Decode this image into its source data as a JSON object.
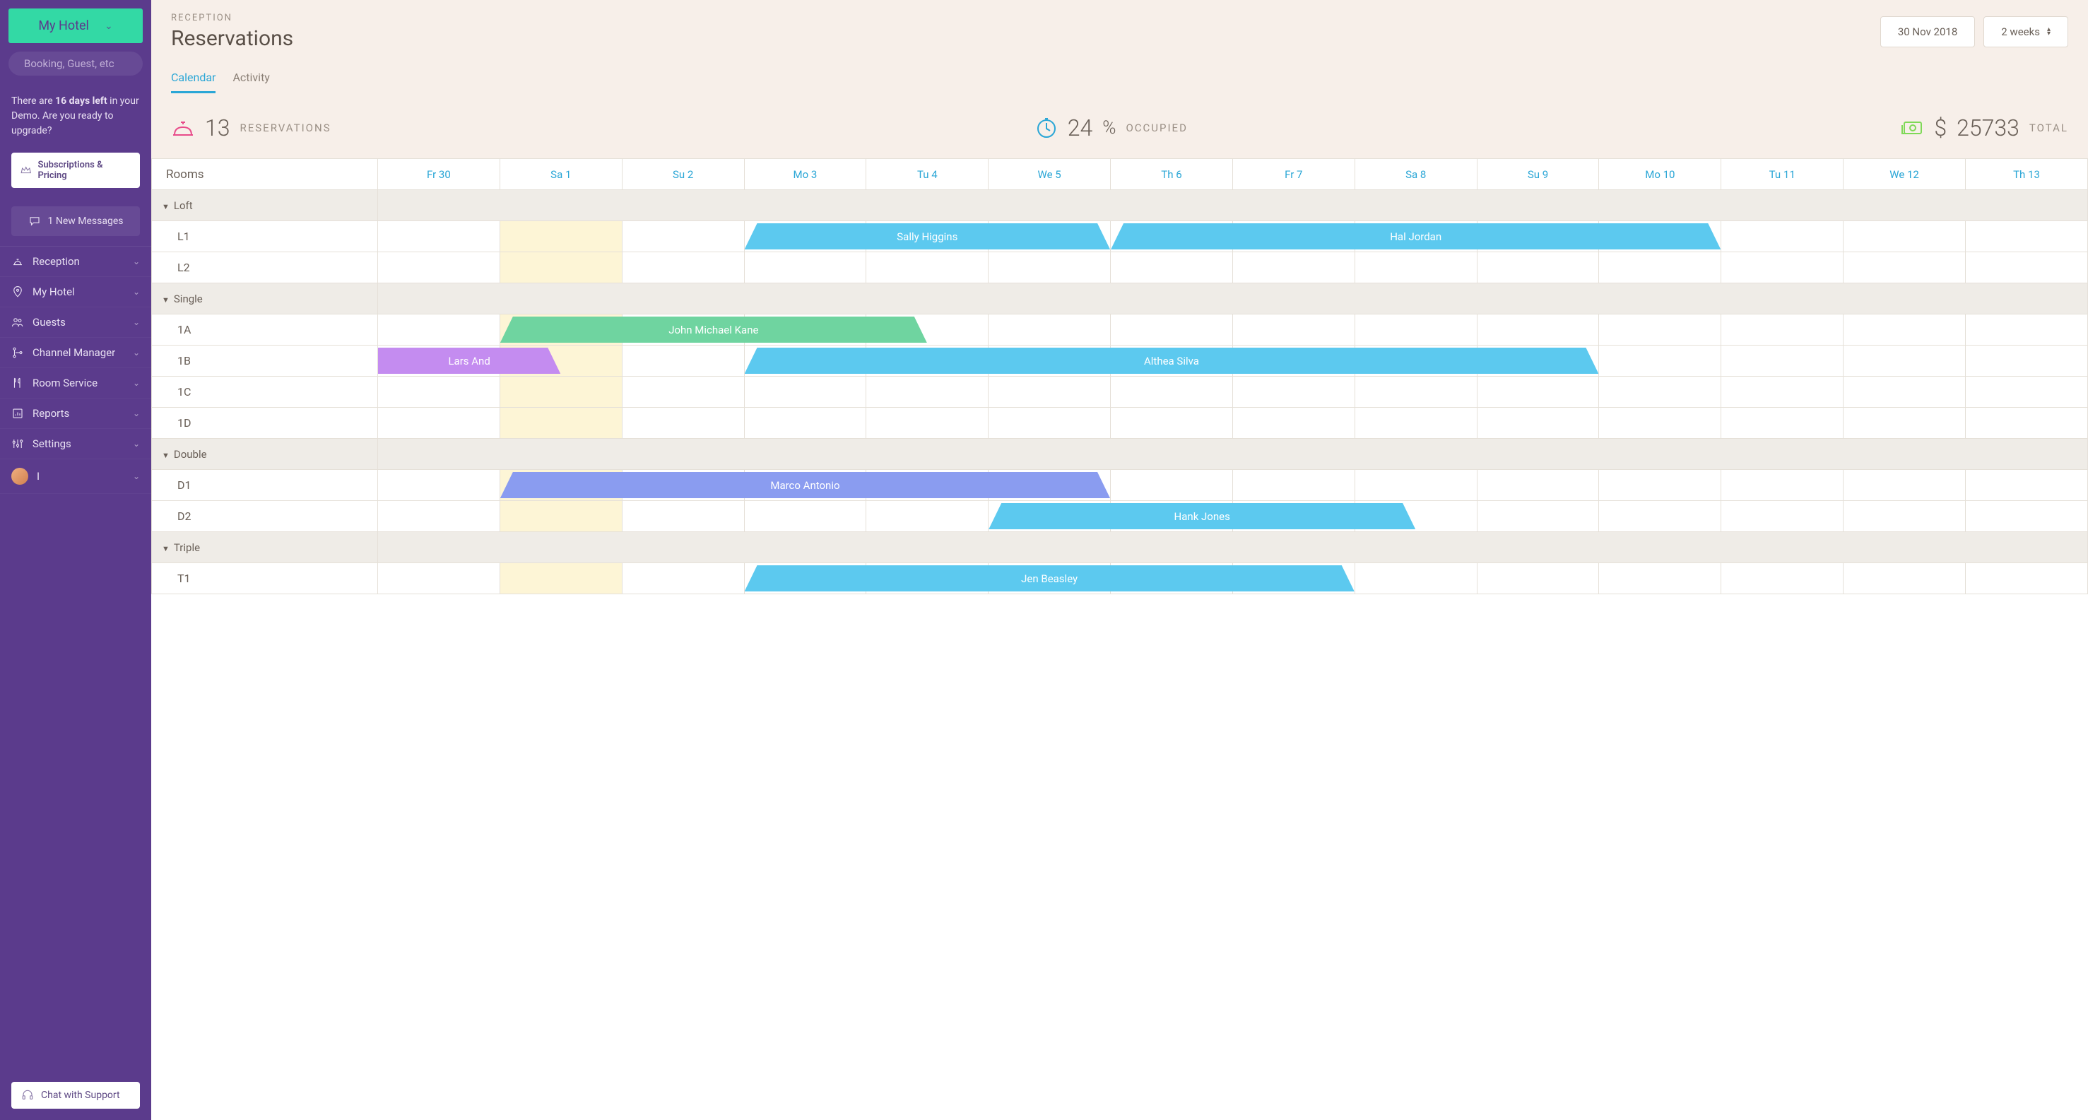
{
  "sidebar": {
    "hotel_select": "My Hotel",
    "search_placeholder": "Booking, Guest, etc",
    "demo_pre": "There are ",
    "demo_bold": "16 days left",
    "demo_post": " in your Demo. Are you ready to upgrade?",
    "subscriptions_label": "Subscriptions & Pricing",
    "messages_label": "1 New Messages",
    "nav": [
      {
        "label": "Reception"
      },
      {
        "label": "My Hotel"
      },
      {
        "label": "Guests"
      },
      {
        "label": "Channel Manager"
      },
      {
        "label": "Room Service"
      },
      {
        "label": "Reports"
      },
      {
        "label": "Settings"
      },
      {
        "label": "I"
      }
    ],
    "support_label": "Chat with Support"
  },
  "header": {
    "breadcrumb": "RECEPTION",
    "title": "Reservations",
    "date_label": "30 Nov 2018",
    "range_label": "2 weeks",
    "tabs": {
      "calendar": "Calendar",
      "activity": "Activity"
    }
  },
  "stats": {
    "reservations_value": "13",
    "reservations_label": "RESERVATIONS",
    "occupied_value": "24",
    "occupied_pct": "%",
    "occupied_label": "OCCUPIED",
    "total_currency": "$",
    "total_value": "25733",
    "total_label": "TOTAL"
  },
  "calendar": {
    "rooms_header": "Rooms",
    "days": [
      "Fr 30",
      "Sa 1",
      "Su 2",
      "Mo 3",
      "Tu 4",
      "We 5",
      "Th 6",
      "Fr 7",
      "Sa 8",
      "Su 9",
      "Mo 10",
      "Tu 11",
      "We 12",
      "Th 13"
    ],
    "today_index": 1,
    "groups": [
      {
        "name": "Loft",
        "rooms": [
          {
            "name": "L1",
            "res": [
              {
                "guest": "Sally Higgins",
                "start": 3,
                "span": 3,
                "color": "#5cc9ef",
                "shape": "normal"
              },
              {
                "guest": "Hal Jordan",
                "start": 6,
                "span": 5,
                "color": "#5cc9ef",
                "shape": "normal"
              }
            ]
          },
          {
            "name": "L2",
            "res": []
          }
        ]
      },
      {
        "name": "Single",
        "rooms": [
          {
            "name": "1A",
            "res": [
              {
                "guest": "John Michael Kane",
                "start": 1,
                "span": 3.5,
                "color": "#6fd4a0",
                "shape": "normal"
              }
            ]
          },
          {
            "name": "1B",
            "res": [
              {
                "guest": "Lars And",
                "start": 0,
                "span": 1.5,
                "color": "#c48cf0",
                "shape": "cut-left"
              },
              {
                "guest": "Althea Silva",
                "start": 3,
                "span": 7,
                "color": "#5cc9ef",
                "shape": "normal"
              }
            ]
          },
          {
            "name": "1C",
            "res": []
          },
          {
            "name": "1D",
            "res": []
          }
        ]
      },
      {
        "name": "Double",
        "rooms": [
          {
            "name": "D1",
            "res": [
              {
                "guest": "Marco Antonio",
                "start": 1,
                "span": 5,
                "color": "#8a9cf0",
                "shape": "normal"
              }
            ]
          },
          {
            "name": "D2",
            "res": [
              {
                "guest": "Hank Jones",
                "start": 5,
                "span": 3.5,
                "color": "#5cc9ef",
                "shape": "normal"
              }
            ]
          }
        ]
      },
      {
        "name": "Triple",
        "rooms": [
          {
            "name": "T1",
            "res": [
              {
                "guest": "Jen Beasley",
                "start": 3,
                "span": 5,
                "color": "#5cc9ef",
                "shape": "normal"
              }
            ]
          }
        ]
      }
    ]
  }
}
